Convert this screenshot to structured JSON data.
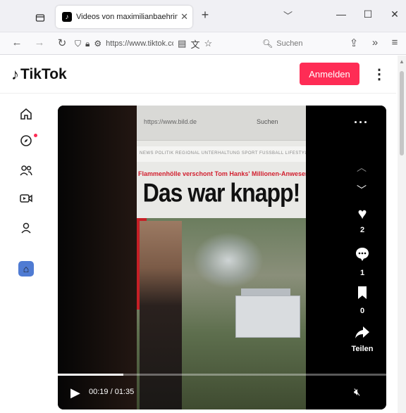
{
  "browser": {
    "tab_title": "Videos von maximilianbaehring",
    "tab_close": "✕",
    "new_tab": "+",
    "url": "https://www.tiktok.com",
    "search_placeholder": "Suchen"
  },
  "tiktok": {
    "logo_text": "TikTok",
    "login_label": "Anmelden"
  },
  "video": {
    "frame_url": "https://www.bild.de",
    "frame_search": "Suchen",
    "frame_nav": "NEWS POLITIK REGIONAL UNTERHALTUNG SPORT FUSSBALL LIFESTYLE RATGEBER AUTO",
    "kicker": "Flammenhölle verschont Tom Hanks' Millionen-Anwesen",
    "headline": "Das war knapp!",
    "likes": "2",
    "comments": "1",
    "saves": "0",
    "share_label": "Teilen",
    "time": "00:19 / 01:35",
    "progress": 0.2
  },
  "icons": {
    "home": "home-icon",
    "explore": "compass-icon",
    "following": "users-icon",
    "live": "live-icon",
    "profile": "profile-icon"
  },
  "colors": {
    "brand": "#fe2c55",
    "notif_dot": "#fe2c55"
  }
}
